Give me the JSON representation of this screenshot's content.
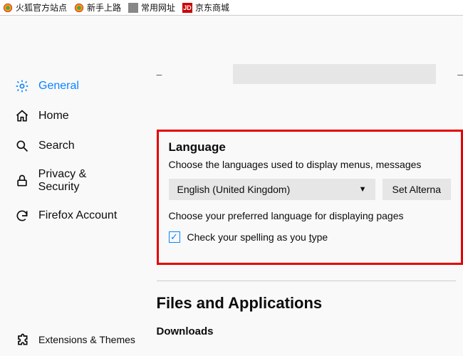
{
  "bookmarks": {
    "b1": "火狐官方站点",
    "b2": "新手上路",
    "b3": "常用网址",
    "b4": "京东商城",
    "b4_badge": "JD"
  },
  "nav": {
    "general": "General",
    "home": "Home",
    "search": "Search",
    "privacy": "Privacy & Security",
    "account": "Firefox Account",
    "extensions": "Extensions & Themes"
  },
  "top": {
    "dash1": "–",
    "dash2": "–"
  },
  "language": {
    "title": "Language",
    "desc": "Choose the languages used to display menus, messages",
    "dropdown_value": "English (United Kingdom)",
    "alt_button": "Set Alterna",
    "subdesc": "Choose your preferred language for displaying pages",
    "spellcheck_pre": "Check your spelling as you ",
    "spellcheck_u": "t",
    "spellcheck_post": "ype"
  },
  "files": {
    "title": "Files and Applications",
    "downloads": "Downloads"
  }
}
